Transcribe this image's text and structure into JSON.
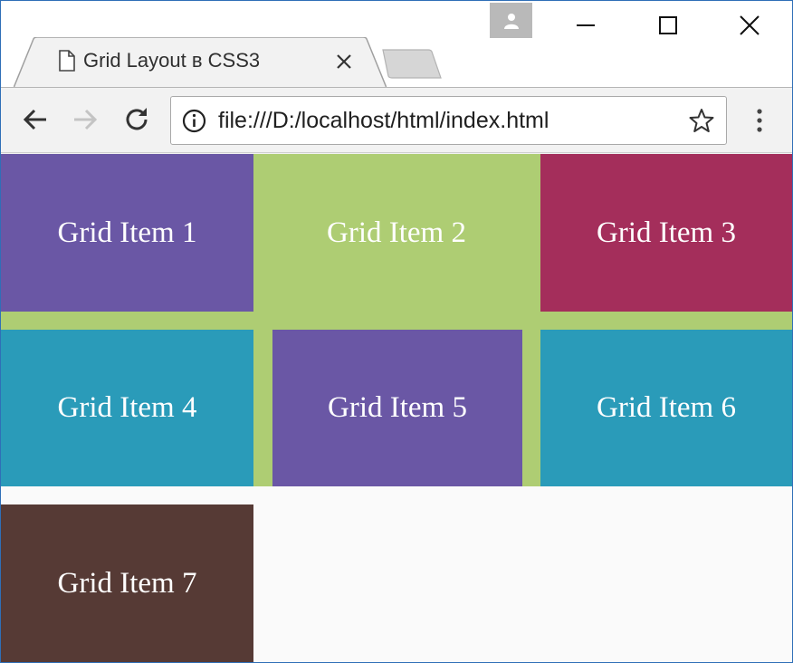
{
  "browser": {
    "tab": {
      "title": "Grid Layout в CSS3"
    },
    "address_bar": {
      "url": "file:///D:/localhost/html/index.html"
    },
    "icons": {
      "profile": "user-icon",
      "minimize": "minimize-icon",
      "maximize": "maximize-icon",
      "close": "close-icon",
      "tab_page": "document-icon",
      "tab_close": "close-icon",
      "back": "arrow-left-icon",
      "forward": "arrow-right-icon",
      "reload": "reload-icon",
      "site_info": "info-icon",
      "bookmark": "star-icon",
      "menu": "kebab-menu-icon"
    }
  },
  "page": {
    "grid_items": [
      {
        "label": "Grid Item 1",
        "color": "#6a57a5"
      },
      {
        "label": "Grid Item 2",
        "color": "#aecd73"
      },
      {
        "label": "Grid Item 3",
        "color": "#a42e5b"
      },
      {
        "label": "Grid Item 4",
        "color": "#2a9bb9"
      },
      {
        "label": "Grid Item 5",
        "color": "#6a57a5"
      },
      {
        "label": "Grid Item 6",
        "color": "#2a9bb9"
      },
      {
        "label": "Grid Item 7",
        "color": "#563a35"
      }
    ]
  }
}
